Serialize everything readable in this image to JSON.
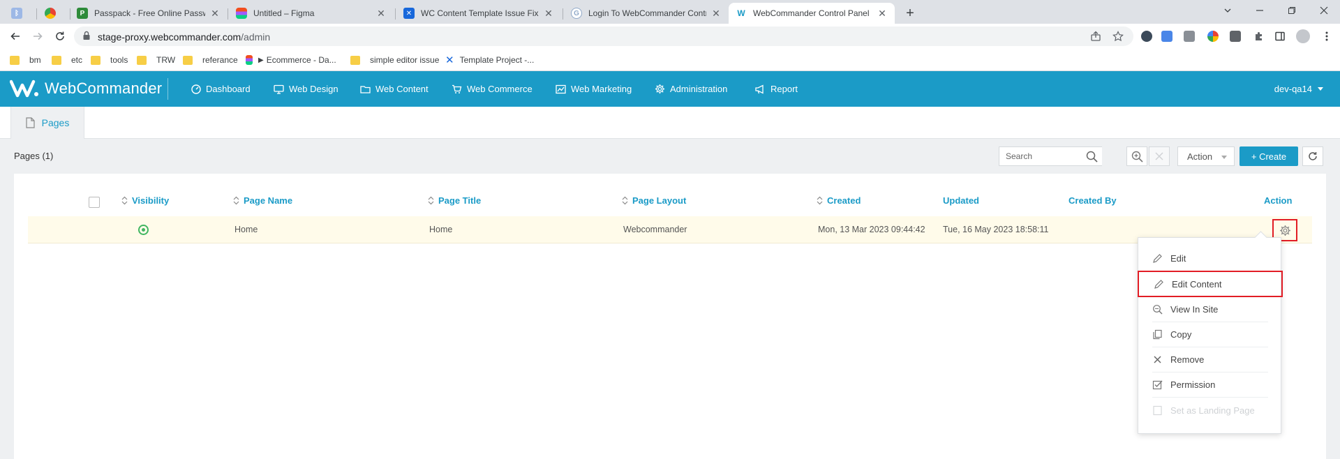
{
  "browser": {
    "tabs": [
      {
        "title": "",
        "favicon_color": "#9db8e6"
      },
      {
        "title": "",
        "favicon_color": "#e94235"
      },
      {
        "title": "Passpack - Free Online Password",
        "favicon_color": "#2e8b3a"
      },
      {
        "title": "Untitled – Figma",
        "favicon_color": "#f24e1e"
      },
      {
        "title": "WC Content Template Issue Fixing",
        "favicon_color": "#1868db"
      },
      {
        "title": "Login To WebCommander Control",
        "favicon_color": "#8fa8c8"
      },
      {
        "title": "WebCommander Control Panel",
        "favicon_color": "#1b9bc7"
      }
    ],
    "url_host": "stage-proxy.webcommander.com",
    "url_path": "/admin",
    "bookmarks": [
      "bm",
      "etc",
      "tools",
      "TRW",
      "referance",
      "Ecommerce - Da...",
      "simple editor issue",
      "Template Project -..."
    ]
  },
  "app": {
    "brand": "WebCommander",
    "brand_color": "#1b9bc7",
    "nav": [
      "Dashboard",
      "Web Design",
      "Web Content",
      "Web Commerce",
      "Web Marketing",
      "Administration",
      "Report"
    ],
    "user": "dev-qa14"
  },
  "subtab": {
    "label": "Pages"
  },
  "toolbar": {
    "count_label": "Pages (1)",
    "search_placeholder": "Search",
    "action_label": "Action",
    "create_label": "+ Create"
  },
  "table": {
    "headers": [
      "Visibility",
      "Page Name",
      "Page Title",
      "Page Layout",
      "Created",
      "Updated",
      "Created By",
      "Action"
    ],
    "rows": [
      {
        "page_name": "Home",
        "page_title": "Home",
        "page_layout": "Webcommander",
        "created": "Mon, 13 Mar 2023 09:44:42",
        "updated": "Tue, 16 May 2023 18:58:11",
        "created_by": ""
      }
    ]
  },
  "action_menu": {
    "items": [
      "Edit",
      "Edit Content",
      "View In Site",
      "Copy",
      "Remove",
      "Permission",
      "Set as Landing Page"
    ],
    "highlighted": "Edit Content",
    "disabled": "Set as Landing Page",
    "highlight_color": "#e21d25"
  }
}
